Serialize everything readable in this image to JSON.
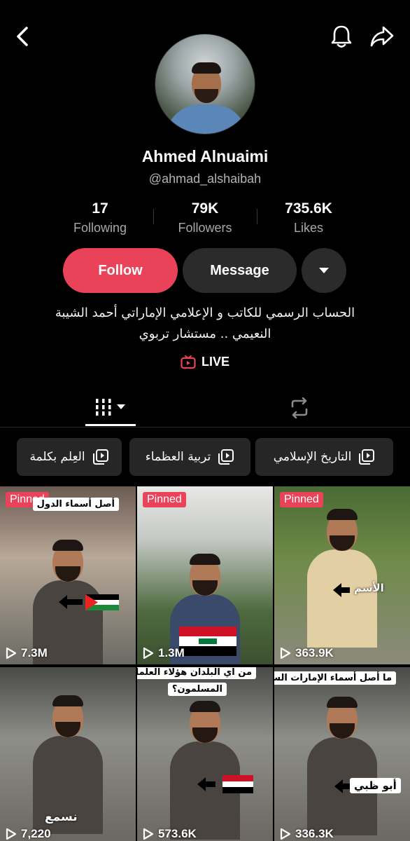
{
  "header": {
    "back_icon": "chevron-left-icon",
    "bell_icon": "bell-icon",
    "share_icon": "share-arrow-icon"
  },
  "profile": {
    "name": "Ahmed Alnuaimi",
    "handle": "@ahmad_alshaibah",
    "stats": [
      {
        "value": "17",
        "label": "Following"
      },
      {
        "value": "79K",
        "label": "Followers"
      },
      {
        "value": "735.6K",
        "label": "Likes"
      }
    ],
    "bio_line1": "الحساب الرسمي للكاتب و الإعلامي الإماراتي أحمد الشيبة",
    "bio_line2": "النعيمي .. مستشار تربوي",
    "live_label": "LIVE"
  },
  "actions": {
    "follow": "Follow",
    "message": "Message"
  },
  "playlists": [
    {
      "label": "التاريخ الإسلامي"
    },
    {
      "label": "تربية العظماء"
    },
    {
      "label": "العِلم بكلمة"
    }
  ],
  "videos": [
    {
      "pinned": "Pinned",
      "views": "7.3M",
      "caption": "أصل أسماء الدول"
    },
    {
      "pinned": "Pinned",
      "views": "1.3M",
      "caption": ""
    },
    {
      "pinned": "Pinned",
      "views": "363.9K",
      "caption": "",
      "overlay": "الأسم"
    },
    {
      "views": "7,220",
      "overlay": "نسمع"
    },
    {
      "views": "573.6K",
      "caption": "من اي البلدان هؤلاء العلماء",
      "caption2": "المسلمون؟"
    },
    {
      "views": "336.3K",
      "caption": "ما أصل أسماء الإمارات السبع؟",
      "overlay": "أبو ظبي"
    }
  ],
  "colors": {
    "accent": "#ea4359",
    "surface": "#2b2b2b"
  }
}
